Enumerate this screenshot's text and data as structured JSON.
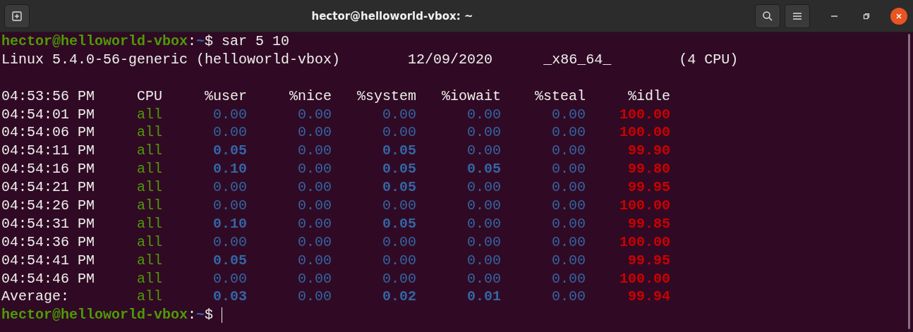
{
  "window": {
    "title": "hector@helloworld-vbox: ~"
  },
  "terminal": {
    "lines": [
      {
        "kind": "prompt",
        "user_host": "hector@helloworld-vbox",
        "separator": ":",
        "path": "~",
        "symbol": "$",
        "command": "sar 5 10",
        "cursor": false
      },
      {
        "kind": "info",
        "fields": [
          "Linux 5.4.0-56-generic (helloworld-vbox)",
          "12/09/2020",
          "_x86_64_",
          "(4 CPU)"
        ]
      },
      {
        "kind": "blank"
      },
      {
        "kind": "header",
        "cells": [
          "04:53:56 PM",
          "CPU",
          "%user",
          "%nice",
          "%system",
          "%iowait",
          "%steal",
          "%idle"
        ]
      },
      {
        "kind": "row",
        "time": "04:54:01 PM",
        "cpu": "all",
        "values": [
          {
            "text": "0.00",
            "bold": false
          },
          {
            "text": "0.00",
            "bold": false
          },
          {
            "text": "0.00",
            "bold": false
          },
          {
            "text": "0.00",
            "bold": false
          },
          {
            "text": "0.00",
            "bold": false
          }
        ],
        "idle": "100.00"
      },
      {
        "kind": "row",
        "time": "04:54:06 PM",
        "cpu": "all",
        "values": [
          {
            "text": "0.00",
            "bold": false
          },
          {
            "text": "0.00",
            "bold": false
          },
          {
            "text": "0.00",
            "bold": false
          },
          {
            "text": "0.00",
            "bold": false
          },
          {
            "text": "0.00",
            "bold": false
          }
        ],
        "idle": "100.00"
      },
      {
        "kind": "row",
        "time": "04:54:11 PM",
        "cpu": "all",
        "values": [
          {
            "text": "0.05",
            "bold": true
          },
          {
            "text": "0.00",
            "bold": false
          },
          {
            "text": "0.05",
            "bold": true
          },
          {
            "text": "0.00",
            "bold": false
          },
          {
            "text": "0.00",
            "bold": false
          }
        ],
        "idle": "99.90"
      },
      {
        "kind": "row",
        "time": "04:54:16 PM",
        "cpu": "all",
        "values": [
          {
            "text": "0.10",
            "bold": true
          },
          {
            "text": "0.00",
            "bold": false
          },
          {
            "text": "0.05",
            "bold": true
          },
          {
            "text": "0.05",
            "bold": true
          },
          {
            "text": "0.00",
            "bold": false
          }
        ],
        "idle": "99.80"
      },
      {
        "kind": "row",
        "time": "04:54:21 PM",
        "cpu": "all",
        "values": [
          {
            "text": "0.00",
            "bold": false
          },
          {
            "text": "0.00",
            "bold": false
          },
          {
            "text": "0.05",
            "bold": true
          },
          {
            "text": "0.00",
            "bold": false
          },
          {
            "text": "0.00",
            "bold": false
          }
        ],
        "idle": "99.95"
      },
      {
        "kind": "row",
        "time": "04:54:26 PM",
        "cpu": "all",
        "values": [
          {
            "text": "0.00",
            "bold": false
          },
          {
            "text": "0.00",
            "bold": false
          },
          {
            "text": "0.00",
            "bold": false
          },
          {
            "text": "0.00",
            "bold": false
          },
          {
            "text": "0.00",
            "bold": false
          }
        ],
        "idle": "100.00"
      },
      {
        "kind": "row",
        "time": "04:54:31 PM",
        "cpu": "all",
        "values": [
          {
            "text": "0.10",
            "bold": true
          },
          {
            "text": "0.00",
            "bold": false
          },
          {
            "text": "0.05",
            "bold": true
          },
          {
            "text": "0.00",
            "bold": false
          },
          {
            "text": "0.00",
            "bold": false
          }
        ],
        "idle": "99.85"
      },
      {
        "kind": "row",
        "time": "04:54:36 PM",
        "cpu": "all",
        "values": [
          {
            "text": "0.00",
            "bold": false
          },
          {
            "text": "0.00",
            "bold": false
          },
          {
            "text": "0.00",
            "bold": false
          },
          {
            "text": "0.00",
            "bold": false
          },
          {
            "text": "0.00",
            "bold": false
          }
        ],
        "idle": "100.00"
      },
      {
        "kind": "row",
        "time": "04:54:41 PM",
        "cpu": "all",
        "values": [
          {
            "text": "0.05",
            "bold": true
          },
          {
            "text": "0.00",
            "bold": false
          },
          {
            "text": "0.00",
            "bold": false
          },
          {
            "text": "0.00",
            "bold": false
          },
          {
            "text": "0.00",
            "bold": false
          }
        ],
        "idle": "99.95"
      },
      {
        "kind": "row",
        "time": "04:54:46 PM",
        "cpu": "all",
        "values": [
          {
            "text": "0.00",
            "bold": false
          },
          {
            "text": "0.00",
            "bold": false
          },
          {
            "text": "0.00",
            "bold": false
          },
          {
            "text": "0.00",
            "bold": false
          },
          {
            "text": "0.00",
            "bold": false
          }
        ],
        "idle": "100.00"
      },
      {
        "kind": "row",
        "time": "Average:",
        "cpu": "all",
        "values": [
          {
            "text": "0.03",
            "bold": true
          },
          {
            "text": "0.00",
            "bold": false
          },
          {
            "text": "0.02",
            "bold": true
          },
          {
            "text": "0.01",
            "bold": true
          },
          {
            "text": "0.00",
            "bold": false
          }
        ],
        "idle": "99.94"
      },
      {
        "kind": "prompt",
        "user_host": "hector@helloworld-vbox",
        "separator": ":",
        "path": "~",
        "symbol": "$",
        "cursor": true
      }
    ]
  }
}
